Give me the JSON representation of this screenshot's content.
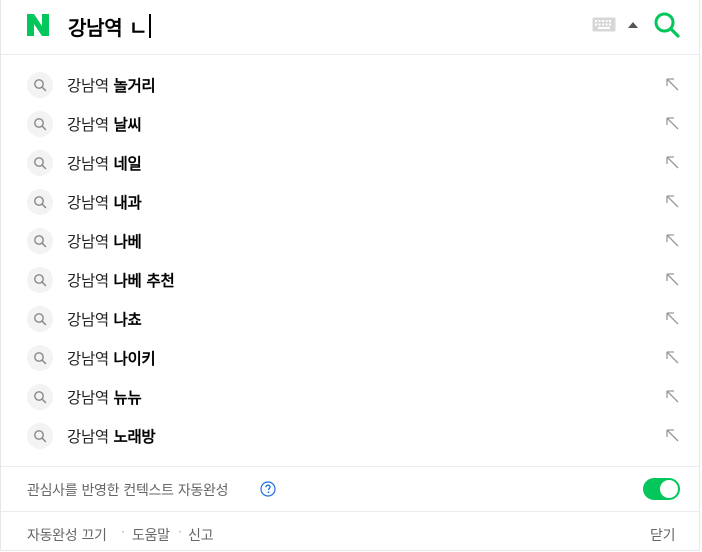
{
  "search": {
    "query": "강남역 ㄴ"
  },
  "suggestions": [
    {
      "prefix": "강남역 ",
      "suffix": "놀거리"
    },
    {
      "prefix": "강남역 ",
      "suffix": "날씨"
    },
    {
      "prefix": "강남역 ",
      "suffix": "네일"
    },
    {
      "prefix": "강남역 ",
      "suffix": "내과"
    },
    {
      "prefix": "강남역 ",
      "suffix": "나베"
    },
    {
      "prefix": "강남역 ",
      "suffix": "나베 추천"
    },
    {
      "prefix": "강남역 ",
      "suffix": "나쵸"
    },
    {
      "prefix": "강남역 ",
      "suffix": "나이키"
    },
    {
      "prefix": "강남역 ",
      "suffix": "뉴뉴"
    },
    {
      "prefix": "강남역 ",
      "suffix": "노래방"
    }
  ],
  "context": {
    "label": "관심사를 반영한 컨텍스트 자동완성",
    "enabled": true
  },
  "footer": {
    "autocomplete_off": "자동완성 끄기",
    "help": "도움말",
    "report": "신고",
    "close": "닫기",
    "separator": "·"
  },
  "colors": {
    "brand": "#03c75a",
    "help_icon": "#1e6fd9"
  },
  "icons": {
    "logo": "naver-n-logo",
    "keyboard": "keyboard-icon",
    "dropdown": "triangle-up-icon",
    "search": "search-icon",
    "suggestion": "search-small-icon",
    "insert": "arrow-up-left-icon",
    "help": "question-circle-icon"
  }
}
